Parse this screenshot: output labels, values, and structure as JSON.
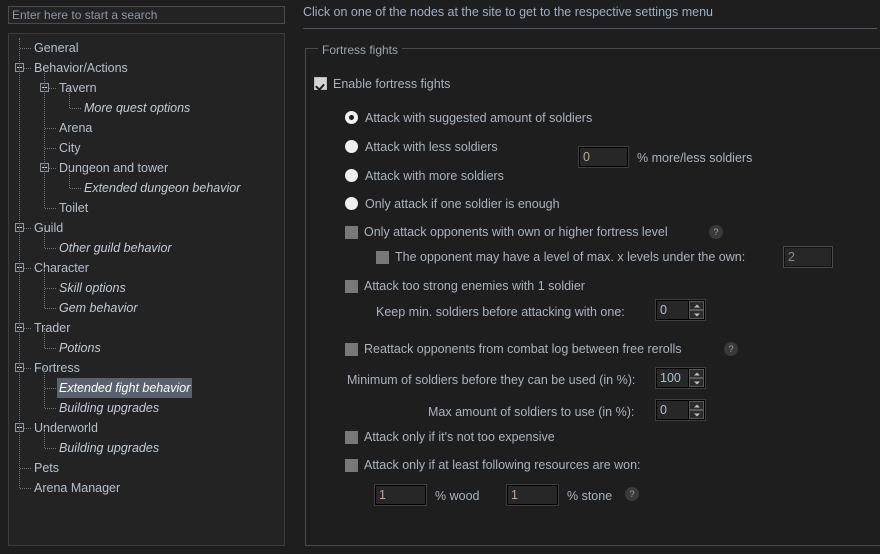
{
  "search": {
    "placeholder": "Enter here to start a search",
    "value": ""
  },
  "tree": {
    "items": [
      {
        "label": "General",
        "depth": 0,
        "expander": false,
        "leaf": false,
        "selected": false
      },
      {
        "label": "Behavior/Actions",
        "depth": 0,
        "expander": true,
        "leaf": false,
        "selected": false
      },
      {
        "label": "Tavern",
        "depth": 1,
        "expander": true,
        "leaf": false,
        "selected": false
      },
      {
        "label": "More quest options",
        "depth": 2,
        "expander": false,
        "leaf": true,
        "selected": false
      },
      {
        "label": "Arena",
        "depth": 1,
        "expander": false,
        "leaf": false,
        "selected": false
      },
      {
        "label": "City",
        "depth": 1,
        "expander": false,
        "leaf": false,
        "selected": false
      },
      {
        "label": "Dungeon and tower",
        "depth": 1,
        "expander": true,
        "leaf": false,
        "selected": false
      },
      {
        "label": "Extended dungeon behavior",
        "depth": 2,
        "expander": false,
        "leaf": true,
        "selected": false
      },
      {
        "label": "Toilet",
        "depth": 1,
        "expander": false,
        "leaf": false,
        "selected": false
      },
      {
        "label": "Guild",
        "depth": 0,
        "expander": true,
        "leaf": false,
        "selected": false
      },
      {
        "label": "Other guild behavior",
        "depth": 1,
        "expander": false,
        "leaf": true,
        "selected": false
      },
      {
        "label": "Character",
        "depth": 0,
        "expander": true,
        "leaf": false,
        "selected": false
      },
      {
        "label": "Skill options",
        "depth": 1,
        "expander": false,
        "leaf": true,
        "selected": false
      },
      {
        "label": "Gem behavior",
        "depth": 1,
        "expander": false,
        "leaf": true,
        "selected": false
      },
      {
        "label": "Trader",
        "depth": 0,
        "expander": true,
        "leaf": false,
        "selected": false
      },
      {
        "label": "Potions",
        "depth": 1,
        "expander": false,
        "leaf": true,
        "selected": false
      },
      {
        "label": "Fortress",
        "depth": 0,
        "expander": true,
        "leaf": false,
        "selected": false
      },
      {
        "label": "Extended fight behavior",
        "depth": 1,
        "expander": false,
        "leaf": true,
        "selected": true
      },
      {
        "label": "Building upgrades",
        "depth": 1,
        "expander": false,
        "leaf": true,
        "selected": false
      },
      {
        "label": "Underworld",
        "depth": 0,
        "expander": true,
        "leaf": false,
        "selected": false
      },
      {
        "label": "Building upgrades",
        "depth": 1,
        "expander": false,
        "leaf": true,
        "selected": false
      },
      {
        "label": "Pets",
        "depth": 0,
        "expander": false,
        "leaf": false,
        "selected": false
      },
      {
        "label": "Arena Manager",
        "depth": 0,
        "expander": false,
        "leaf": false,
        "selected": false
      }
    ],
    "selected_highlight_color": "#59636f"
  },
  "right": {
    "header": "Click on one of the nodes at the site to get to the respective settings menu",
    "groupbox_title": "Fortress fights",
    "enable_fortress_fights": {
      "label": "Enable fortress fights",
      "checked": true
    },
    "soldier_amount_radios": [
      {
        "label": "Attack with suggested amount of soldiers",
        "selected": true
      },
      {
        "label": "Attack with less soldiers",
        "selected": false
      },
      {
        "label": "Attack with more soldiers",
        "selected": false
      },
      {
        "label": "Only attack if one soldier is enough",
        "selected": false
      }
    ],
    "more_less_soldiers": {
      "value": "0",
      "suffix_label": "% more/less soldiers"
    },
    "own_or_higher_level": {
      "label": "Only attack opponents with own or higher fortress level",
      "checked": false,
      "help_icon": "question-mark-icon"
    },
    "max_levels_under": {
      "label": "The opponent may have a level of max. x levels under the own:",
      "checked": false,
      "value": "2"
    },
    "attack_too_strong": {
      "label": "Attack too strong enemies with 1 soldier",
      "checked": false
    },
    "keep_min_soldiers": {
      "label": "Keep min. soldiers before attacking with one:",
      "value": "0"
    },
    "reattack_from_log": {
      "label": "Reattack opponents from combat log between free rerolls",
      "checked": false,
      "help_icon": "question-mark-icon"
    },
    "minimum_soldiers_percent": {
      "label": "Minimum of soldiers before they can be used (in %):",
      "value": "100"
    },
    "max_soldiers_percent": {
      "label": "Max amount of soldiers to use (in %):",
      "value": "0"
    },
    "not_too_expensive": {
      "label": "Attack only if it's not too expensive",
      "checked": false
    },
    "least_resources_won": {
      "label": "Attack only if at least following resources are won:",
      "checked": false
    },
    "wood": {
      "value": "1",
      "suffix_label": "% wood"
    },
    "stone": {
      "value": "1",
      "suffix_label": "% stone",
      "help_icon": "question-mark-icon"
    }
  },
  "colors": {
    "window_bg": "#1e1e1e",
    "panel_bg": "#232323",
    "text": "#a9b3c0",
    "header_text": "#9fb0c4",
    "input_text": "#c8a878",
    "spinner_text": "#a8c3cf",
    "border": "#4a4a4a",
    "selection": "#59636f"
  }
}
